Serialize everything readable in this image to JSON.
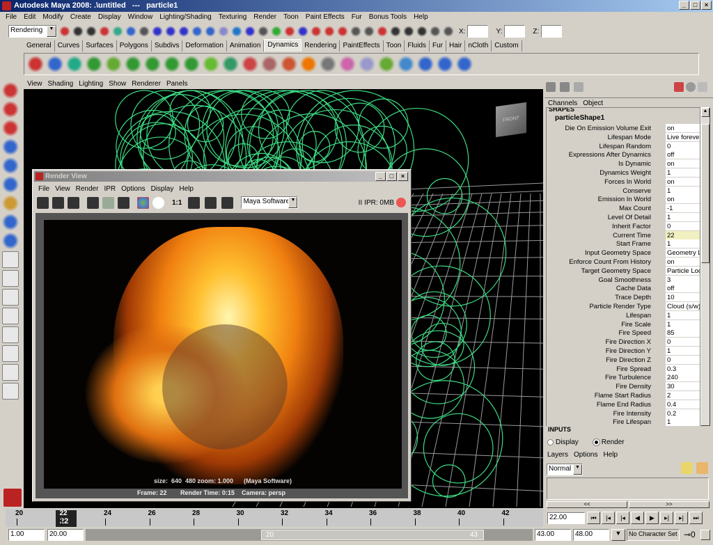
{
  "window": {
    "title": "Autodesk Maya 2008: .\\untitled   ---   particle1"
  },
  "menu": [
    "File",
    "Edit",
    "Modify",
    "Create",
    "Display",
    "Window",
    "Lighting/Shading",
    "Texturing",
    "Render",
    "Toon",
    "Paint Effects",
    "Fur",
    "Bonus Tools",
    "Help"
  ],
  "status_line": {
    "menu_set": "Rendering",
    "x_label": "X:",
    "y_label": "Y:",
    "z_label": "Z:",
    "x": "",
    "y": "",
    "z": ""
  },
  "shelf_tabs": [
    "General",
    "Curves",
    "Surfaces",
    "Polygons",
    "Subdivs",
    "Deformation",
    "Animation",
    "Dynamics",
    "Rendering",
    "PaintEffects",
    "Toon",
    "Fluids",
    "Fur",
    "Hair",
    "nCloth",
    "Custom"
  ],
  "active_shelf_tab": "Dynamics",
  "viewport_menu": [
    "View",
    "Shading",
    "Lighting",
    "Show",
    "Renderer",
    "Panels"
  ],
  "viewcube": {
    "label": "FRONT"
  },
  "channel_box": {
    "menu": [
      "Channels",
      "Object"
    ],
    "section_shapes": "SHAPES",
    "shape_name": "particleShape1",
    "section_inputs": "INPUTS",
    "highlighted": "Current Time",
    "attributes": [
      [
        "Die On Emission Volume Exit",
        "on"
      ],
      [
        "Lifespan Mode",
        "Live forever"
      ],
      [
        "Lifespan Random",
        "0"
      ],
      [
        "Expressions After Dynamics",
        "off"
      ],
      [
        "Is Dynamic",
        "on"
      ],
      [
        "Dynamics Weight",
        "1"
      ],
      [
        "Forces In World",
        "on"
      ],
      [
        "Conserve",
        "1"
      ],
      [
        "Emission In World",
        "on"
      ],
      [
        "Max Count",
        "-1"
      ],
      [
        "Level Of Detail",
        "1"
      ],
      [
        "Inherit Factor",
        "0"
      ],
      [
        "Current Time",
        "22"
      ],
      [
        "Start Frame",
        "1"
      ],
      [
        "Input Geometry Space",
        "Geometry Lo"
      ],
      [
        "Enforce Count From History",
        "on"
      ],
      [
        "Target Geometry Space",
        "Particle Loc"
      ],
      [
        "Goal Smoothness",
        "3"
      ],
      [
        "Cache Data",
        "off"
      ],
      [
        "Trace Depth",
        "10"
      ],
      [
        "Particle Render Type",
        "Cloud (s/w)"
      ],
      [
        "Lifespan",
        "1"
      ],
      [
        "Fire Scale",
        "1"
      ],
      [
        "Fire Speed",
        "85"
      ],
      [
        "Fire Direction X",
        "0"
      ],
      [
        "Fire Direction Y",
        "1"
      ],
      [
        "Fire Direction Z",
        "0"
      ],
      [
        "Fire Spread",
        "0.3"
      ],
      [
        "Fire Turbulence",
        "240"
      ],
      [
        "Fire Density",
        "30"
      ],
      [
        "Flame Start Radius",
        "2"
      ],
      [
        "Flame End Radius",
        "0.4"
      ],
      [
        "Fire Intensity",
        "0.2"
      ],
      [
        "Fire Lifespan",
        "1"
      ]
    ]
  },
  "layer_editor": {
    "display_label": "Display",
    "render_label": "Render",
    "selected": "Render",
    "menu": [
      "Layers",
      "Options",
      "Help"
    ],
    "layer_type": "Normal"
  },
  "render_view": {
    "title": "Render View",
    "menu": [
      "File",
      "View",
      "Render",
      "IPR",
      "Options",
      "Display",
      "Help"
    ],
    "ratio": "1:1",
    "renderer": "Maya Software",
    "ipr": "IPR: 0MB",
    "info": "size:  640  480 zoom: 1.000      (Maya Software)",
    "frame": "Frame: 22",
    "render_time": "Render Time: 0:15",
    "camera": "Camera: persp"
  },
  "timeline": {
    "ticks": [
      "20",
      "22",
      "24",
      "26",
      "28",
      "30",
      "32",
      "34",
      "36",
      "38",
      "40",
      "42"
    ],
    "current": "22",
    "current_time": "22.00"
  },
  "range": {
    "start": "1.00",
    "playback_start": "20.00",
    "slider_start": "20",
    "slider_end": "43",
    "playback_end": "43.00",
    "end": "48.00",
    "character_set": "No Character Set"
  },
  "colors": {
    "title": "#0a246a",
    "particles": "#3ddc84",
    "grid": "#9a9a9a",
    "highlight": "#f0f0c0"
  }
}
